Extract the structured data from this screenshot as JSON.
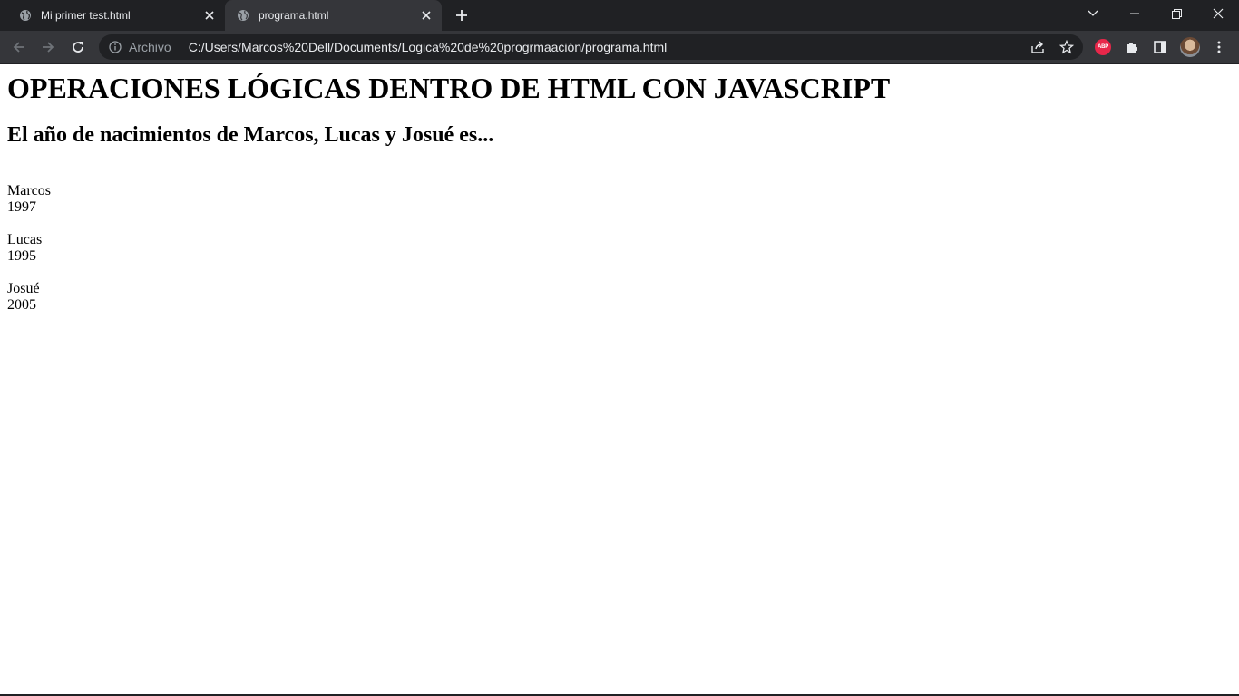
{
  "browser": {
    "tabs": [
      {
        "title": "Mi primer test.html",
        "icon": "globe-icon",
        "active": false
      },
      {
        "title": "programa.html",
        "icon": "globe-icon",
        "active": true
      }
    ],
    "omnibox": {
      "security_label": "Archivo",
      "url": "C:/Users/Marcos%20Dell/Documents/Logica%20de%20progrmaación/programa.html"
    },
    "extension_badge": "ABP",
    "colors": {
      "frame": "#202124",
      "toolbar": "#35363a",
      "text": "#e8eaed",
      "abp_red": "#e8274a"
    }
  },
  "page": {
    "heading": "OPERACIONES LÓGICAS DENTRO DE HTML CON JAVASCRIPT",
    "subheading": "El año de nacimientos de Marcos, Lucas y Josué es...",
    "people": [
      {
        "name": "Marcos",
        "year": "1997"
      },
      {
        "name": "Lucas",
        "year": "1995"
      },
      {
        "name": "Josué",
        "year": "2005"
      }
    ]
  }
}
